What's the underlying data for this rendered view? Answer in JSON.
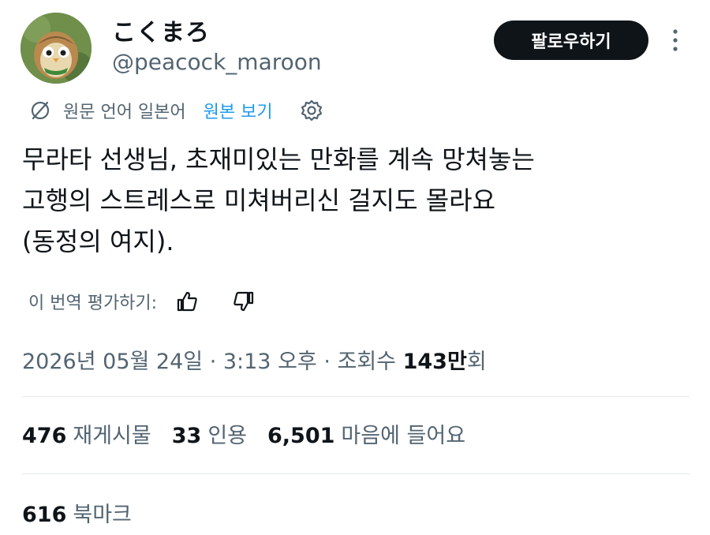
{
  "user": {
    "display_name": "こくまろ",
    "handle": "@peacock_maroon"
  },
  "header": {
    "follow_label": "팔로우하기"
  },
  "translation": {
    "source_language": "원문 언어 일본어",
    "view_original": "원본 보기"
  },
  "tweet": {
    "lines": [
      "무라타 선생님, 초재미있는 만화를 계속 망쳐놓는",
      "고행의 스트레스로 미쳐버리신 걸지도 몰라요",
      "(동정의 여지)."
    ]
  },
  "rate": {
    "label": "이 번역 평가하기:"
  },
  "meta": {
    "datetime": "2026년 05월 24일 · 3:13 오후 · 조회수 ",
    "views": "143만",
    "views_suffix": "회"
  },
  "stats": [
    {
      "count": "476",
      "label": "재게시물"
    },
    {
      "count": "33",
      "label": "인용"
    },
    {
      "count": "6,501",
      "label": "마음에 들어요"
    }
  ],
  "bookmarks": {
    "count": "616",
    "label": "북마크"
  },
  "colors": {
    "text": "#0f1419",
    "secondary": "#536471",
    "link": "#1d9bf0",
    "follow_bg": "#0f1419",
    "divider": "#e6e8ea"
  },
  "icons": [
    "avatar-owl",
    "more-vertical-icon",
    "translate-off-icon",
    "gear-icon",
    "thumbs-up-icon",
    "thumbs-down-icon"
  ]
}
